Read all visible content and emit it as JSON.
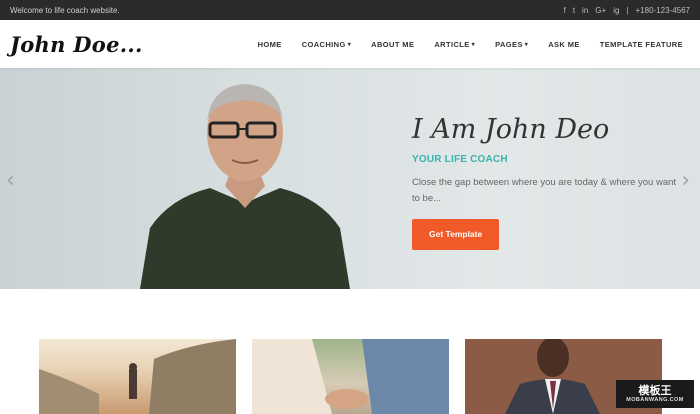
{
  "topbar": {
    "welcome": "Welcome to life coach website.",
    "phone": "+180-123-4567",
    "social": [
      "f",
      "t",
      "in",
      "G+",
      "ig"
    ]
  },
  "header": {
    "logo": "John Doe...",
    "nav": [
      {
        "label": "HOME",
        "dropdown": false
      },
      {
        "label": "COACHING",
        "dropdown": true
      },
      {
        "label": "ABOUT ME",
        "dropdown": false
      },
      {
        "label": "ARTICLE",
        "dropdown": true
      },
      {
        "label": "PAGES",
        "dropdown": true
      },
      {
        "label": "ASK ME",
        "dropdown": false
      },
      {
        "label": "TEMPLATE FEATURE",
        "dropdown": false
      }
    ]
  },
  "hero": {
    "title": "I Am John Deo",
    "subtitle": "YOUR LIFE COACH",
    "description": "Close the gap between where you are today & where you want to be...",
    "cta": "Get Template"
  },
  "watermark": {
    "main": "模板王",
    "sub": "MOBANWANG.COM"
  },
  "colors": {
    "accent": "#f05a28",
    "teal": "#3bb3ad",
    "topbar": "#2b2b2b"
  }
}
